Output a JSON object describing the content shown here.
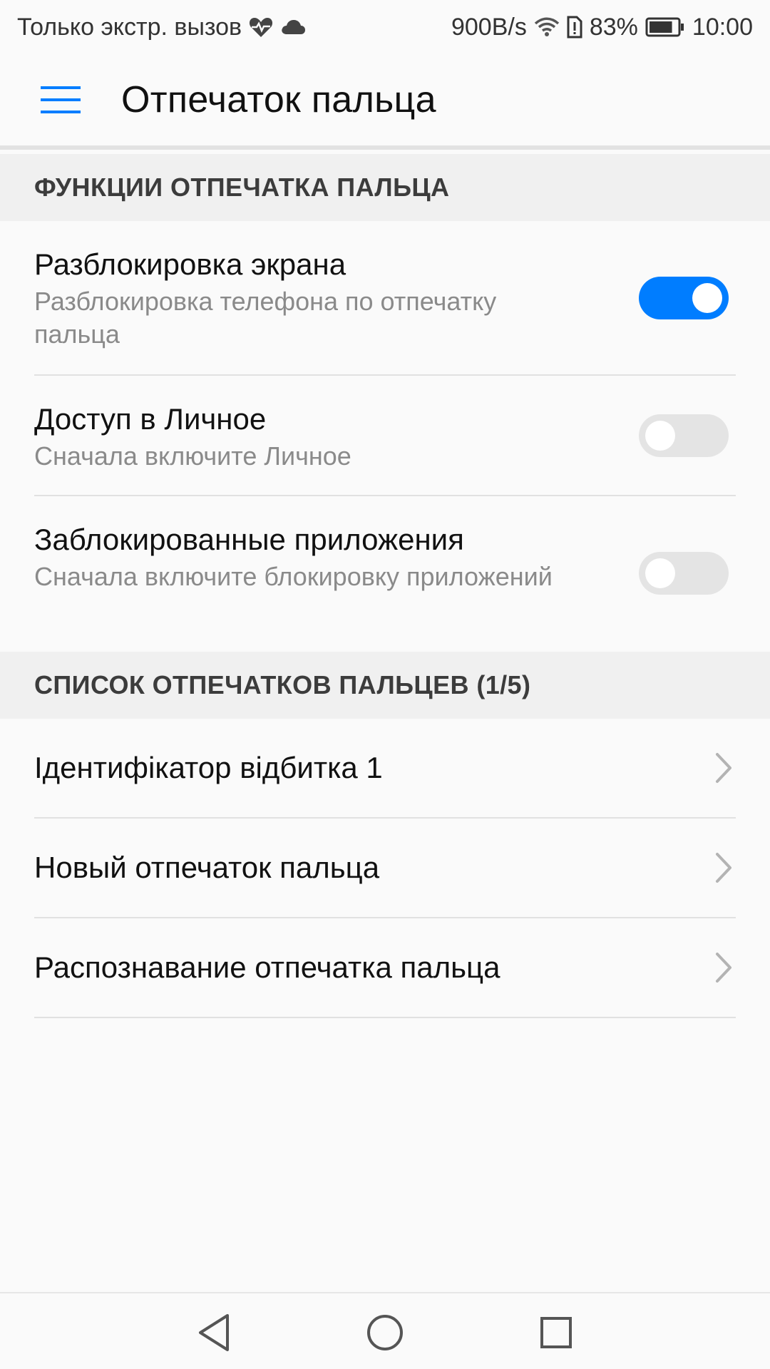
{
  "status_bar": {
    "carrier_text": "Только экстр. вызов",
    "left_icons": [
      "heart-pulse-icon",
      "cloud-icon"
    ],
    "network_speed": "900B/s",
    "battery_percent": "83%",
    "battery_level": 0.83,
    "time": "10:00"
  },
  "app_bar": {
    "title": "Отпечаток пальца",
    "menu_icon": "hamburger-menu-icon"
  },
  "sections": {
    "functions_header": "ФУНКЦИИ ОТПЕЧАТКА ПАЛЬЦА",
    "list_header": "СПИСОК ОТПЕЧАТКОВ ПАЛЬЦЕВ (1/5)"
  },
  "settings": [
    {
      "title": "Разблокировка экрана",
      "subtitle": "Разблокировка телефона по отпечатку пальца",
      "enabled": true
    },
    {
      "title": "Доступ в Личное",
      "subtitle": "Сначала включите Личное",
      "enabled": false
    },
    {
      "title": "Заблокированные приложения",
      "subtitle": "Сначала включите блокировку приложений",
      "enabled": false
    }
  ],
  "fingerprints": [
    {
      "label": "Ідентифікатор відбитка 1"
    },
    {
      "label": "Новый отпечаток пальца"
    },
    {
      "label": "Распознавание отпечатка пальца"
    }
  ],
  "colors": {
    "accent": "#007dff",
    "switch_off": "#e4e4e4",
    "section_bg": "#f0f0f0",
    "background": "#fafafa"
  },
  "nav_bar": {
    "icons": [
      "back-icon",
      "home-icon",
      "recents-icon"
    ]
  }
}
